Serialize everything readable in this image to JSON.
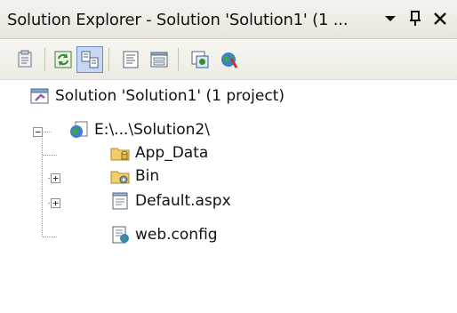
{
  "window": {
    "title": "Solution Explorer - Solution 'Solution1' (1 ...",
    "dropdown_glyph": "▾",
    "pin_glyph": "Ⅎ",
    "close_glyph": "✕"
  },
  "toolbar": {
    "items": [
      {
        "name": "properties-icon"
      },
      {
        "name": "refresh-icon"
      },
      {
        "name": "nest-related-files-icon"
      },
      {
        "name": "view-code-icon"
      },
      {
        "name": "view-designer-icon"
      },
      {
        "name": "copy-website-icon"
      },
      {
        "name": "aspnet-configuration-icon"
      }
    ]
  },
  "tree": {
    "solution": "Solution 'Solution1' (1 project)",
    "project": "E:\\...\\Solution2\\",
    "children": [
      {
        "label": "App_Data",
        "icon": "folder-icon",
        "expandable": false
      },
      {
        "label": "Bin",
        "icon": "bin-folder-icon",
        "expandable": true
      },
      {
        "label": "Default.aspx",
        "icon": "aspx-file-icon",
        "expandable": true
      },
      {
        "label": "web.config",
        "icon": "config-file-icon",
        "expandable": false
      }
    ],
    "expand_symbol": "+",
    "collapse_symbol": "−"
  },
  "colors": {
    "toolbar_active": "#c7d7f2",
    "toolbar_active_border": "#6d8ec6",
    "folder_yellow": "#f0cf6a"
  }
}
